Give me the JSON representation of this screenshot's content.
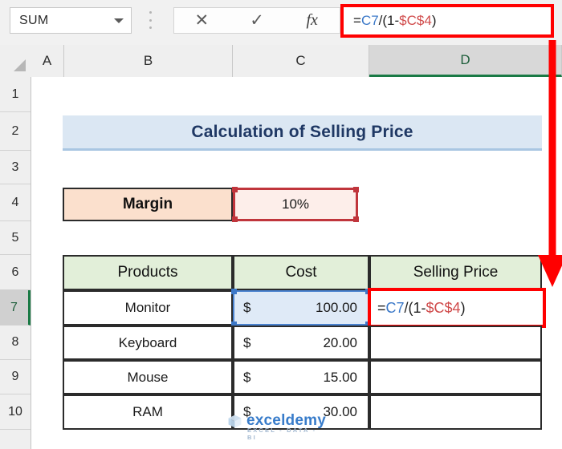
{
  "formula_bar": {
    "name_box_value": "SUM",
    "dropdown_icon": "chevron-down-icon",
    "cancel_icon": "✕",
    "confirm_icon": "✓",
    "insert_function_icon": "fx",
    "formula_tokens": [
      {
        "t": "=",
        "c": "plain"
      },
      {
        "t": "C7",
        "c": "blue"
      },
      {
        "t": "/(1-",
        "c": "plain"
      },
      {
        "t": "$C$4",
        "c": "red"
      },
      {
        "t": ")",
        "c": "plain"
      }
    ],
    "formula_text": "=C7/(1-$C$4)"
  },
  "sheet": {
    "columns": [
      {
        "label": "A",
        "active": false
      },
      {
        "label": "B",
        "active": false
      },
      {
        "label": "C",
        "active": false
      },
      {
        "label": "D",
        "active": true
      }
    ],
    "rows": [
      {
        "label": "1",
        "active": false
      },
      {
        "label": "2",
        "active": false
      },
      {
        "label": "3",
        "active": false
      },
      {
        "label": "4",
        "active": false
      },
      {
        "label": "5",
        "active": false
      },
      {
        "label": "6",
        "active": false
      },
      {
        "label": "7",
        "active": true
      },
      {
        "label": "8",
        "active": false
      },
      {
        "label": "9",
        "active": false
      },
      {
        "label": "10",
        "active": false
      }
    ],
    "title": "Calculation of Selling Price",
    "margin_label": "Margin",
    "margin_value": "10%",
    "table_headers": [
      "Products",
      "Cost",
      "Selling Price"
    ],
    "table_rows": [
      {
        "product": "Monitor",
        "currency": "$",
        "cost": "100.00",
        "selling_price": "=C7/(1-$C$4)"
      },
      {
        "product": "Keyboard",
        "currency": "$",
        "cost": "20.00",
        "selling_price": ""
      },
      {
        "product": "Mouse",
        "currency": "$",
        "cost": "15.00",
        "selling_price": ""
      },
      {
        "product": "RAM",
        "currency": "$",
        "cost": "30.00",
        "selling_price": ""
      }
    ],
    "editing_cell_tokens": [
      {
        "t": "=",
        "c": "plain"
      },
      {
        "t": "C7",
        "c": "blue"
      },
      {
        "t": "/(1-",
        "c": "plain"
      },
      {
        "t": "$C$4",
        "c": "red"
      },
      {
        "t": ")",
        "c": "plain"
      }
    ]
  },
  "annotations": {
    "arrow_color": "#ff0000",
    "formula_box_color": "#ff0000",
    "cell_box_color": "#ff0000",
    "ref_blue_color": "#3d78c8",
    "ref_red_color": "#c0353c",
    "active_accent_color": "#1a7a45"
  },
  "watermark": {
    "main": "exceldemy",
    "sub": "EXCEL - DATA - BI"
  }
}
